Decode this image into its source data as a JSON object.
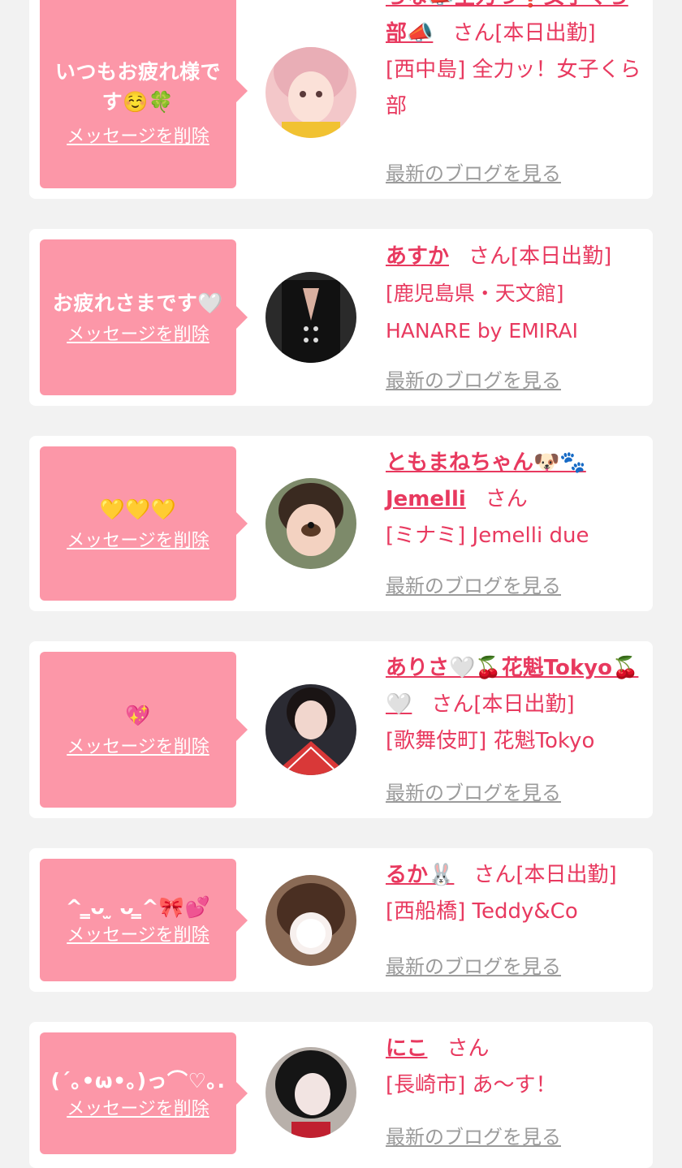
{
  "cards": [
    {
      "message": "いつもお疲れ様です☺️🍀",
      "delete_label": "メッセージを削除",
      "name": "らな📣全力っ❗️女子くら部📣",
      "san": "さん",
      "status": "[本日出勤]",
      "location": "[西中島] 全力ッ！女子くら部",
      "blog_label": "最新のブログを見る"
    },
    {
      "message": "お疲れさまです🤍",
      "delete_label": "メッセージを削除",
      "name": "あすか",
      "san": "さん",
      "status": "[本日出勤]",
      "location": "[鹿児島県・天文館] HANARE by EMIRAI",
      "blog_label": "最新のブログを見る"
    },
    {
      "message": "💛💛💛",
      "delete_label": "メッセージを削除",
      "name": "ともまねちゃん🐶🐾Jemelli",
      "san": "さん",
      "status": "",
      "location": "[ミナミ] Jemelli due",
      "blog_label": "最新のブログを見る"
    },
    {
      "message": "💖",
      "delete_label": "メッセージを削除",
      "name": "ありさ🤍🍒花魁Tokyo🍒🤍",
      "san": "さん",
      "status": "[本日出勤]",
      "location": "[歌舞伎町] 花魁Tokyo",
      "blog_label": "最新のブログを見る"
    },
    {
      "message": "^ ̳ᴗ ̫ ᴗ ̳^🎀💕",
      "delete_label": "メッセージを削除",
      "name": "るか🐰",
      "san": "さん",
      "status": "[本日出勤]",
      "location": "[西船橋] Teddy&Co",
      "blog_label": "最新のブログを見る"
    },
    {
      "message": "(´｡•ω•｡)っ⌒♡｡.",
      "delete_label": "メッセージを削除",
      "name": "にこ",
      "san": "さん",
      "status": "",
      "location": "[長崎市] あ〜す！",
      "blog_label": "最新のブログを見る"
    }
  ]
}
